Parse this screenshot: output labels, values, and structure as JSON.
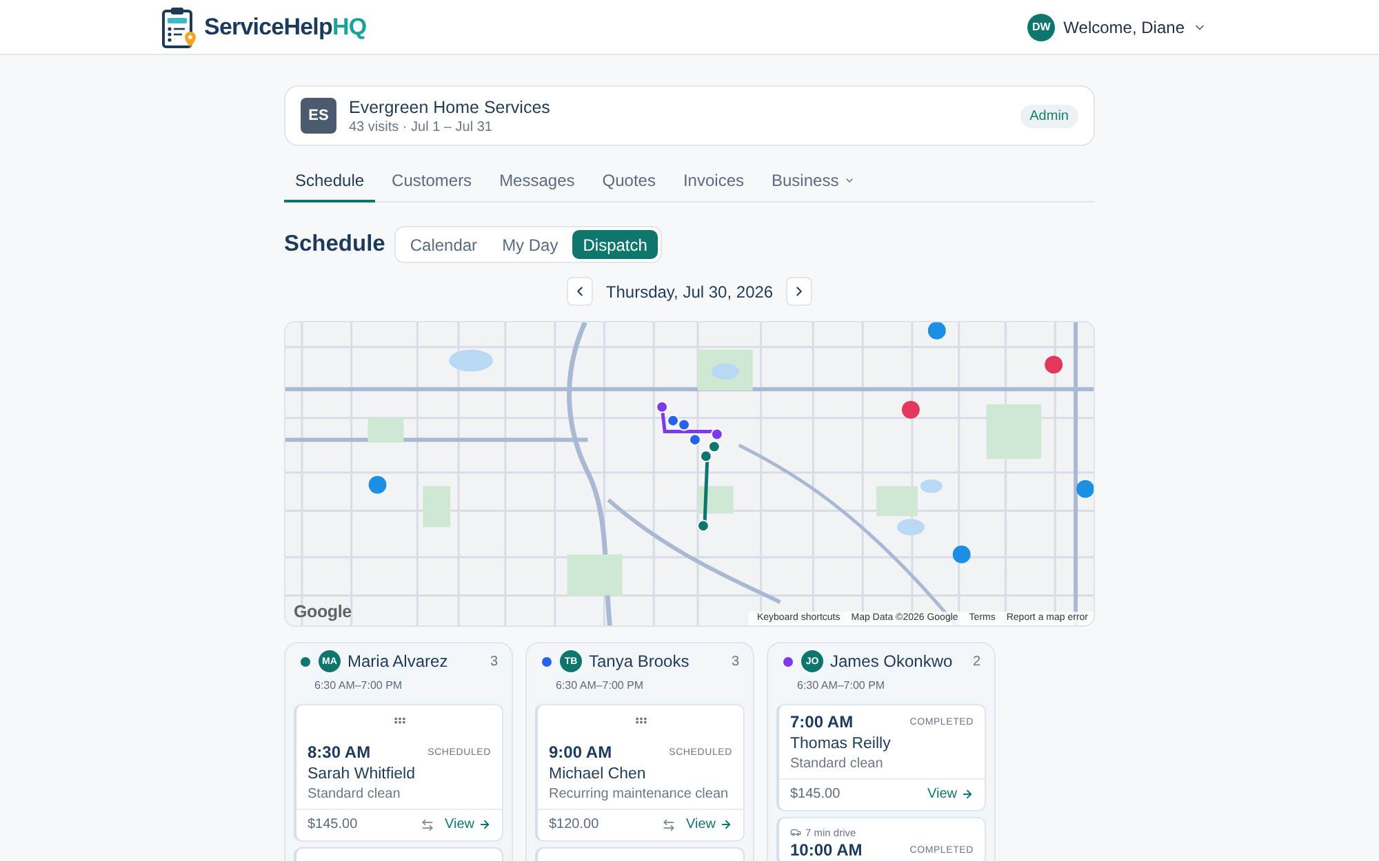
{
  "header": {
    "brand": {
      "name": "ServiceHelp",
      "suffix": "HQ"
    },
    "user": {
      "initials": "DW",
      "greeting": "Welcome, Diane"
    }
  },
  "account": {
    "initials": "ES",
    "name": "Evergreen Home Services",
    "summary": "43 visits · Jul 1 – Jul 31",
    "role": "Admin"
  },
  "tabs": [
    {
      "label": "Schedule",
      "selected": true,
      "dropdown": false
    },
    {
      "label": "Customers",
      "selected": false,
      "dropdown": false
    },
    {
      "label": "Messages",
      "selected": false,
      "dropdown": false
    },
    {
      "label": "Quotes",
      "selected": false,
      "dropdown": false
    },
    {
      "label": "Invoices",
      "selected": false,
      "dropdown": false
    },
    {
      "label": "Business",
      "selected": false,
      "dropdown": true
    }
  ],
  "page": {
    "title": "Schedule",
    "views": [
      {
        "label": "Calendar",
        "selected": false
      },
      {
        "label": "My Day",
        "selected": false
      },
      {
        "label": "Dispatch",
        "selected": true
      }
    ],
    "date": "Thursday, Jul 30, 2026"
  },
  "map": {
    "logo": "Google",
    "attribution": [
      "Keyboard shortcuts",
      "Map Data ©2026 Google",
      "Terms",
      "Report a map error"
    ]
  },
  "dispatch": {
    "columns": [
      {
        "color": "#0f766e",
        "initials": "MA",
        "name": "Maria Alvarez",
        "count": "3",
        "hours": "6:30 AM–7:00 PM",
        "more_below": true,
        "jobs": [
          {
            "draggable": true,
            "time": "8:30 AM",
            "status": "SCHEDULED",
            "customer": "Sarah Whitfield",
            "service": "Standard clean",
            "price": "$145.00",
            "reassign": true,
            "action": "View"
          }
        ]
      },
      {
        "color": "#2563eb",
        "initials": "TB",
        "name": "Tanya Brooks",
        "count": "3",
        "hours": "6:30 AM–7:00 PM",
        "more_below": true,
        "jobs": [
          {
            "draggable": true,
            "time": "9:00 AM",
            "status": "SCHEDULED",
            "customer": "Michael Chen",
            "service": "Recurring maintenance clean",
            "price": "$120.00",
            "reassign": true,
            "action": "View"
          }
        ]
      },
      {
        "color": "#7c3aed",
        "initials": "JO",
        "name": "James Okonkwo",
        "count": "2",
        "hours": "6:30 AM–7:00 PM",
        "more_below": false,
        "jobs": [
          {
            "draggable": false,
            "time": "7:00 AM",
            "status": "COMPLETED",
            "customer": "Thomas Reilly",
            "service": "Standard clean",
            "price": "$145.00",
            "reassign": false,
            "action": "View"
          },
          {
            "draggable": false,
            "drive": "7 min drive",
            "time": "10:00 AM",
            "status": "COMPLETED"
          }
        ]
      }
    ]
  }
}
